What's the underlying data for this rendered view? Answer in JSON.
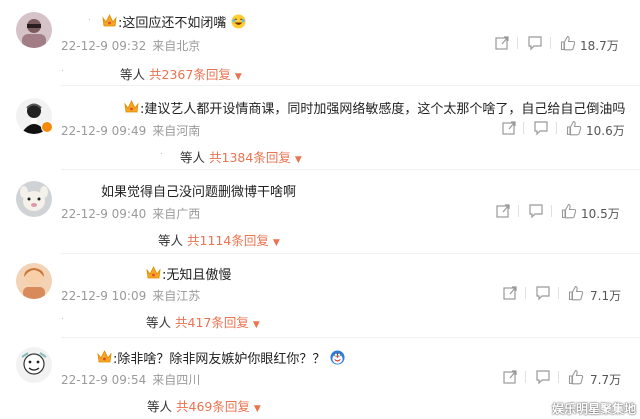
{
  "comments": [
    {
      "username": ".",
      "content": ":这回应还不如闭嘴",
      "date": "22-12-9 09:32",
      "location": "来自北京",
      "likes": "18.7万",
      "reply_who": "等人",
      "reply_count": "共2367条回复",
      "avatar_color": "#c9b0b8"
    },
    {
      "username": "",
      "content": ":建议艺人都开设情商课，同时加强网络敏感度，这个太那个啥了，自己给自己倒油吗",
      "date": "22-12-9 09:49",
      "location": "来自河南",
      "likes": "10.6万",
      "reply_who": "等人",
      "reply_count": "共1384条回复",
      "avatar_color": "#2b2b2b"
    },
    {
      "username": "",
      "content": "如果觉得自己没问题删微博干啥啊",
      "date": "22-12-9 09:40",
      "location": "来自广西",
      "likes": "10.5万",
      "reply_who": "等人",
      "reply_count": "共1114条回复",
      "avatar_color": "#d9d7d2"
    },
    {
      "username": "",
      "content": ":无知且傲慢",
      "date": "22-12-9 10:09",
      "location": "来自江苏",
      "likes": "7.1万",
      "reply_who": "等人",
      "reply_count": "共417条回复",
      "avatar_color": "#e8b58a"
    },
    {
      "username": "",
      "content": ":除非啥？除非网友嫉妒你眼红你？？",
      "date": "22-12-9 09:54",
      "location": "来自四川",
      "likes": "7.7万",
      "reply_who": "等人",
      "reply_count": "共469条回复",
      "avatar_color": "#e6e6e6"
    }
  ],
  "watermark": "娱乐明星聚集地",
  "colors": {
    "accent": "#eb7350",
    "meta": "#9a9a9a",
    "crown": "#f5a623"
  }
}
